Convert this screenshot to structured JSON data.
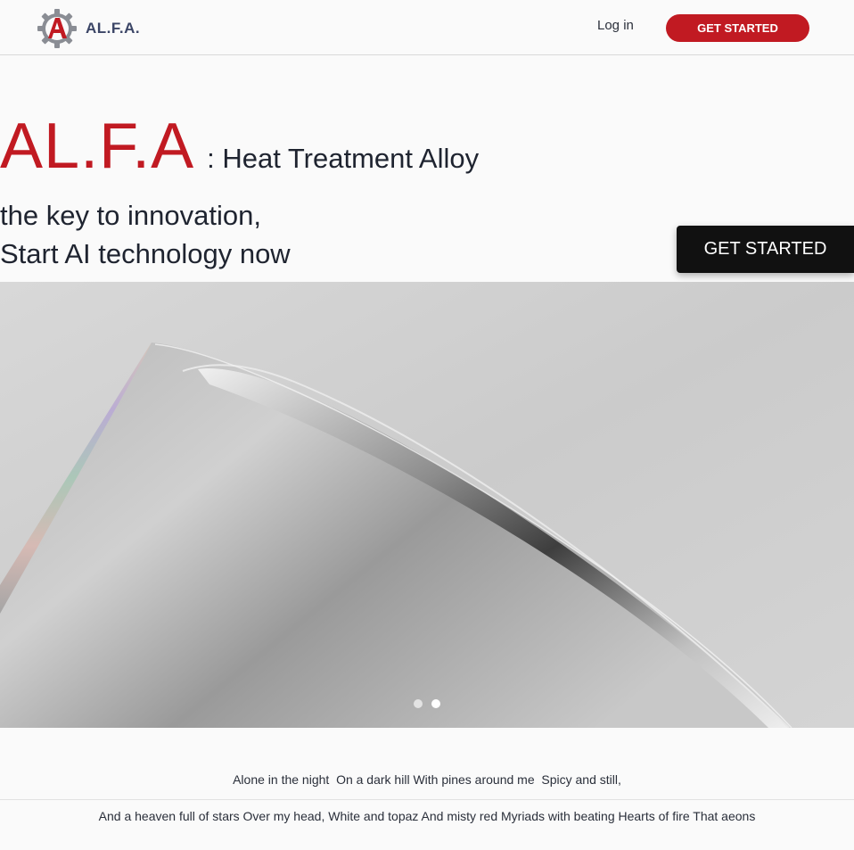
{
  "header": {
    "logo_text": "AL.F.A.",
    "login_label": "Log in",
    "cta_label": "GET STARTED"
  },
  "hero": {
    "brand": "AL.F.A",
    "subtitle": ": Heat Treatment Alloy",
    "tagline_line1": "the key to innovation,",
    "tagline_line2": "Start AI technology now",
    "cta_label": "GET STARTED"
  },
  "carousel": {
    "slide_count": 2,
    "active_slide": 2,
    "image_icon": "metal-tube-image"
  },
  "poem": {
    "line1": "Alone in the night  On a dark hill With pines around me  Spicy and still,",
    "line2": "And a heaven full of stars Over my head, White and topaz And misty red Myriads with beating Hearts of fire That aeons"
  },
  "colors": {
    "brand_red": "#c11a22",
    "logo_blue": "#3b4566",
    "hero_button": "#111111"
  }
}
